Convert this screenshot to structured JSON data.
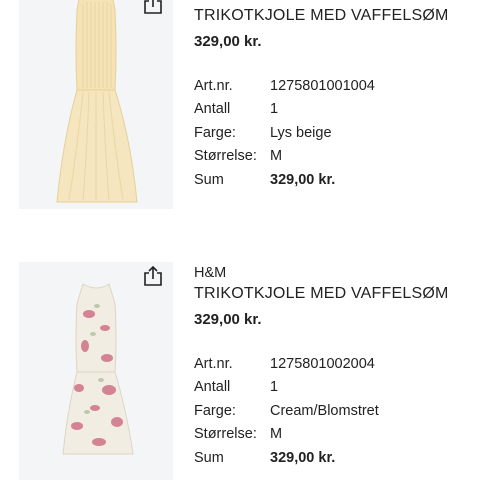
{
  "items": [
    {
      "brand": "",
      "title": "TRIKOTKJOLE MED VAFFELSØM",
      "price": "329,00 kr.",
      "details": [
        {
          "label": "Art.nr.",
          "value": "1275801001004"
        },
        {
          "label": "Antall",
          "value": "1"
        },
        {
          "label": "Farge:",
          "value": "Lys beige"
        },
        {
          "label": "Størrelse:",
          "value": "M"
        },
        {
          "label": "Sum",
          "value": "329,00 kr."
        }
      ],
      "dress_color": "#f6e6bf",
      "icon": "share-icon"
    },
    {
      "brand": "H&M",
      "title": "TRIKOTKJOLE MED VAFFELSØM",
      "price": "329,00 kr.",
      "details": [
        {
          "label": "Art.nr.",
          "value": "1275801002004"
        },
        {
          "label": "Antall",
          "value": "1"
        },
        {
          "label": "Farge:",
          "value": "Cream/Blomstret"
        },
        {
          "label": "Størrelse:",
          "value": "M"
        },
        {
          "label": "Sum",
          "value": "329,00 kr."
        }
      ],
      "dress_color": "#f2ede2",
      "flower_color": "#c9607a",
      "icon": "share-icon"
    }
  ]
}
